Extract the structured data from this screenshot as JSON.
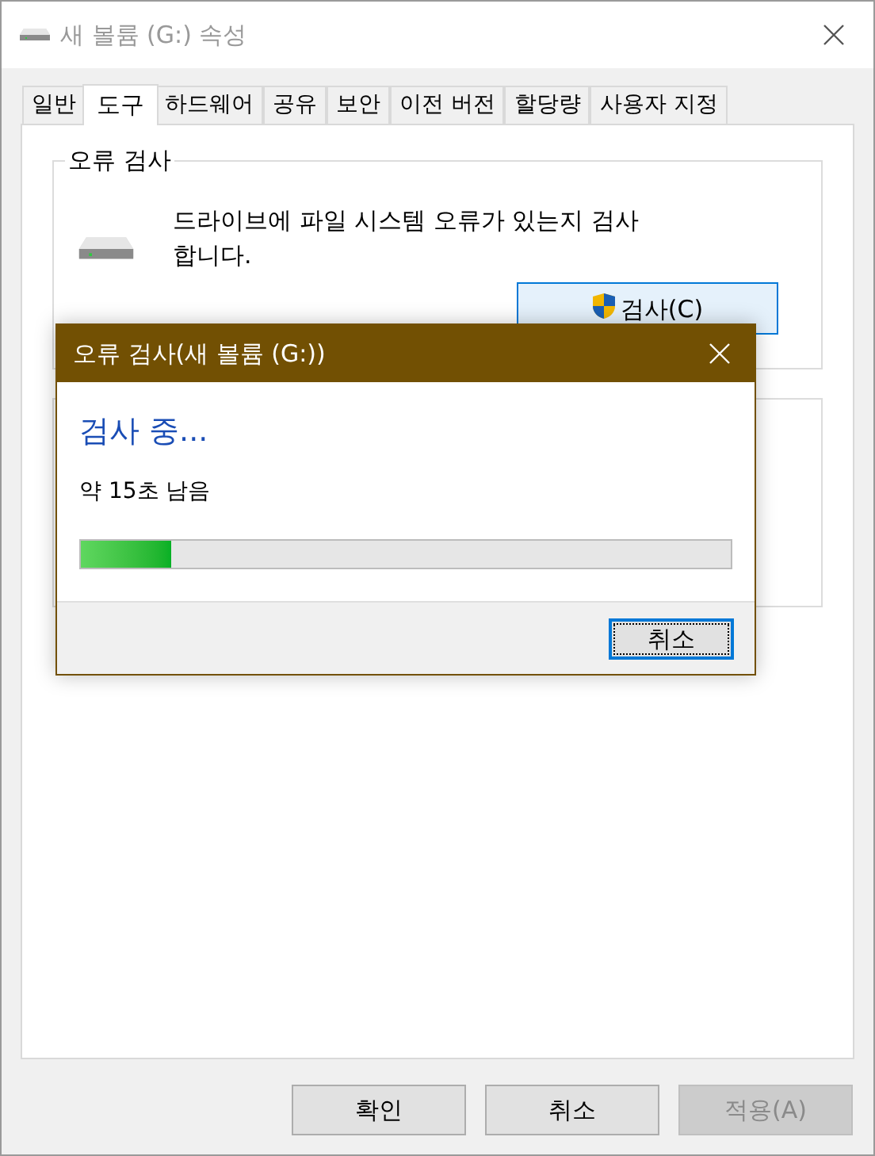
{
  "window": {
    "title": "새 볼륨 (G:) 속성"
  },
  "tabs": [
    {
      "label": "일반",
      "selected": false
    },
    {
      "label": "도구",
      "selected": true
    },
    {
      "label": "하드웨어",
      "selected": false
    },
    {
      "label": "공유",
      "selected": false
    },
    {
      "label": "보안",
      "selected": false
    },
    {
      "label": "이전 버전",
      "selected": false
    },
    {
      "label": "할당량",
      "selected": false
    },
    {
      "label": "사용자 지정",
      "selected": false
    }
  ],
  "error_check": {
    "title": "오류 검사",
    "description": "드라이브에 파일 시스템 오류가 있는지 검사 합니다.",
    "button": "검사(C)"
  },
  "dialog": {
    "title": "오류 검사(새 볼륨 (G:))",
    "heading": "검사 중...",
    "remaining": "약 15초 남음",
    "progress": {
      "level": 0.14
    },
    "button": "취소"
  },
  "buttons": [
    {
      "label": "확인",
      "disabled": false
    },
    {
      "label": "취소",
      "disabled": false
    },
    {
      "label": "적용(A)",
      "disabled": true
    }
  ]
}
